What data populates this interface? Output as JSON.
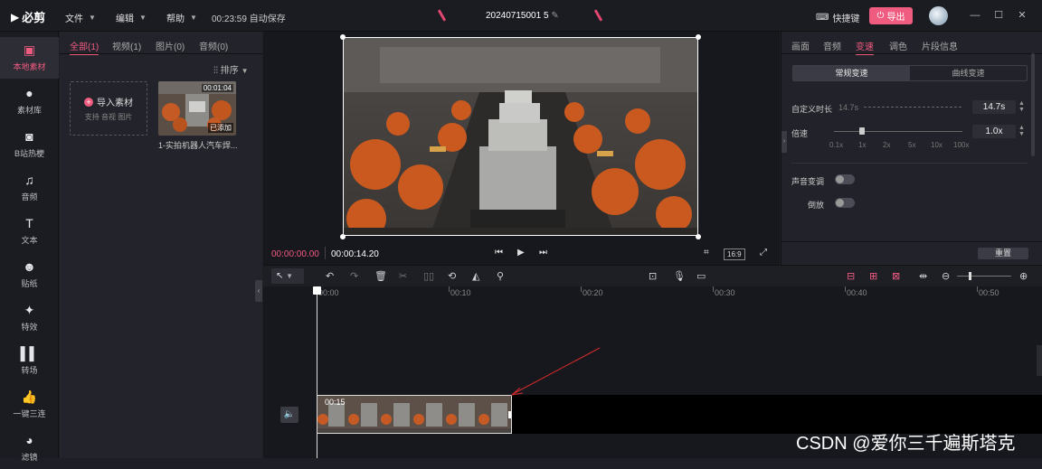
{
  "app": {
    "logo_text": "必剪",
    "menus": [
      "文件",
      "编辑",
      "帮助"
    ],
    "autosave": "00:23:59 自动保存",
    "project_name": "20240715001 5",
    "shortcut": "快捷键",
    "export_label": "导出"
  },
  "leftnav": [
    {
      "label": "本地素材",
      "icon": "folder-icon",
      "glyph": "▣",
      "active": true
    },
    {
      "label": "素材库",
      "icon": "library-icon",
      "glyph": "●"
    },
    {
      "label": "B站热梗",
      "icon": "bilibili-tv-icon",
      "glyph": "◙"
    },
    {
      "label": "音频",
      "icon": "music-note-icon",
      "glyph": "♫"
    },
    {
      "label": "文本",
      "icon": "text-icon",
      "glyph": "T"
    },
    {
      "label": "贴纸",
      "icon": "sticker-icon",
      "glyph": "☻"
    },
    {
      "label": "特效",
      "icon": "effects-star-icon",
      "glyph": "✦"
    },
    {
      "label": "转场",
      "icon": "transition-icon",
      "glyph": "▌▌"
    },
    {
      "label": "一键三连",
      "icon": "thumbs-up-icon",
      "glyph": "👍"
    },
    {
      "label": "滤镜",
      "icon": "filter-icon",
      "glyph": "◕"
    }
  ],
  "media": {
    "tabs": [
      "全部(1)",
      "视频(1)",
      "图片(0)",
      "音频(0)"
    ],
    "sort_label": "排序",
    "import_label": "导入素材",
    "import_sub": "支持 音视 图片",
    "clip": {
      "duration": "00:01:04",
      "badge": "已添加",
      "name": "1-实拍机器人汽车焊..."
    }
  },
  "preview": {
    "time_current": "00:00:00.00",
    "time_total": "00:00:14.20",
    "ratio": "16:9"
  },
  "rpanel": {
    "tabs": [
      "画面",
      "音频",
      "变速",
      "调色",
      "片段信息"
    ],
    "active_tab": 2,
    "speed_modes": [
      "常规变速",
      "曲线变速"
    ],
    "custom_duration_label": "自定义时长",
    "custom_duration_hint": "14.7s",
    "custom_duration_value": "14.7s",
    "rate_label": "倍速",
    "rate_value": "1.0x",
    "rate_ticks": [
      "0.1x",
      "1x",
      "2x",
      "5x",
      "10x",
      "100x"
    ],
    "voice_change_label": "声音变调",
    "reverse_label": "倒放",
    "reset_label": "重置"
  },
  "timeline": {
    "ruler": [
      "00:00",
      "00:10",
      "00:20",
      "00:30",
      "00:40",
      "00:50"
    ],
    "clip_label": "00:15"
  },
  "watermark": "CSDN @爱你三千遍斯塔克"
}
